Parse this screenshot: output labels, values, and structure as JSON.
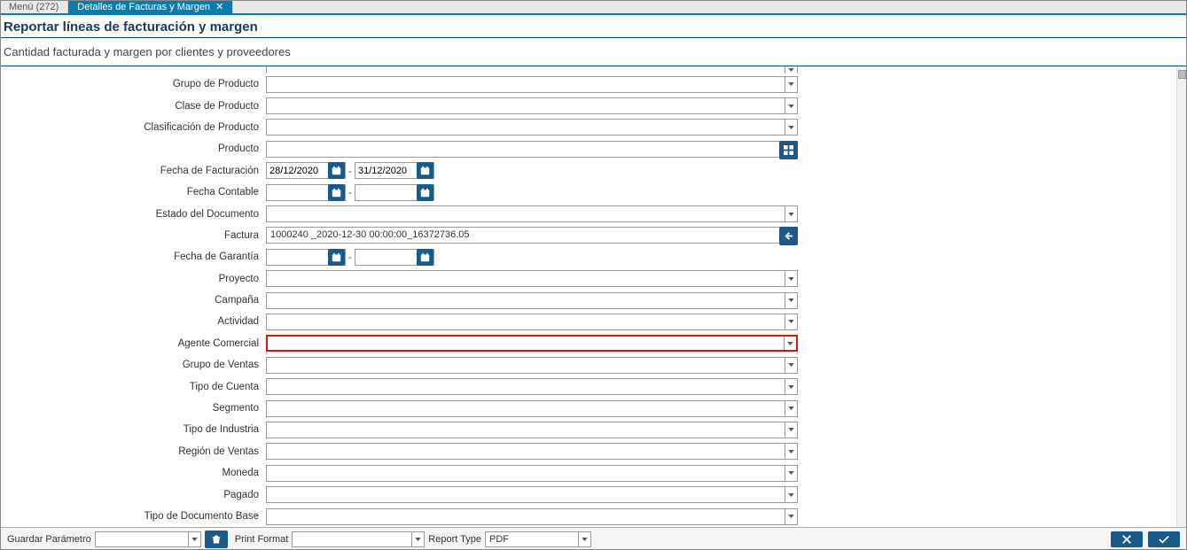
{
  "tabs": {
    "menu": "Menú (272)",
    "active": "Detalles de Facturas y Margen"
  },
  "header": {
    "title": "Reportar líneas de facturación y margen",
    "subtitle": "Cantidad facturada y margen por clientes y proveedores"
  },
  "form": {
    "rows": [
      {
        "label": "Grupo de Producto",
        "type": "combo",
        "value": ""
      },
      {
        "label": "Clase de Producto",
        "type": "combo",
        "value": ""
      },
      {
        "label": "Clasificación de Producto",
        "type": "combo",
        "value": ""
      },
      {
        "label": "Producto",
        "type": "lookup-grid",
        "value": ""
      },
      {
        "label": "Fecha de Facturación",
        "type": "date-range",
        "from": "28/12/2020",
        "to": "31/12/2020"
      },
      {
        "label": "Fecha Contable",
        "type": "date-range",
        "from": "",
        "to": ""
      },
      {
        "label": "Estado del Documento",
        "type": "combo",
        "value": ""
      },
      {
        "label": "Factura",
        "type": "lookup-arrow",
        "value": "1000240 _2020-12-30 00:00:00_16372736.05"
      },
      {
        "label": "Fecha de Garantía",
        "type": "date-range",
        "from": "",
        "to": ""
      },
      {
        "label": "Proyecto",
        "type": "combo",
        "value": ""
      },
      {
        "label": "Campaña",
        "type": "combo",
        "value": ""
      },
      {
        "label": "Actividad",
        "type": "combo",
        "value": ""
      },
      {
        "label": "Agente Comercial",
        "type": "combo",
        "value": "",
        "highlight": true
      },
      {
        "label": "Grupo de Ventas",
        "type": "combo",
        "value": ""
      },
      {
        "label": "Tipo de Cuenta",
        "type": "combo",
        "value": ""
      },
      {
        "label": "Segmento",
        "type": "combo",
        "value": ""
      },
      {
        "label": "Tipo de Industria",
        "type": "combo",
        "value": ""
      },
      {
        "label": "Región de Ventas",
        "type": "combo",
        "value": ""
      },
      {
        "label": "Moneda",
        "type": "combo",
        "value": ""
      },
      {
        "label": "Pagado",
        "type": "combo",
        "value": ""
      },
      {
        "label": "Tipo de Documento Base",
        "type": "combo",
        "value": ""
      }
    ]
  },
  "footer": {
    "save_param": "Guardar Parámetro",
    "print_format": "Print Format",
    "report_type": "Report Type",
    "report_type_value": "PDF"
  }
}
